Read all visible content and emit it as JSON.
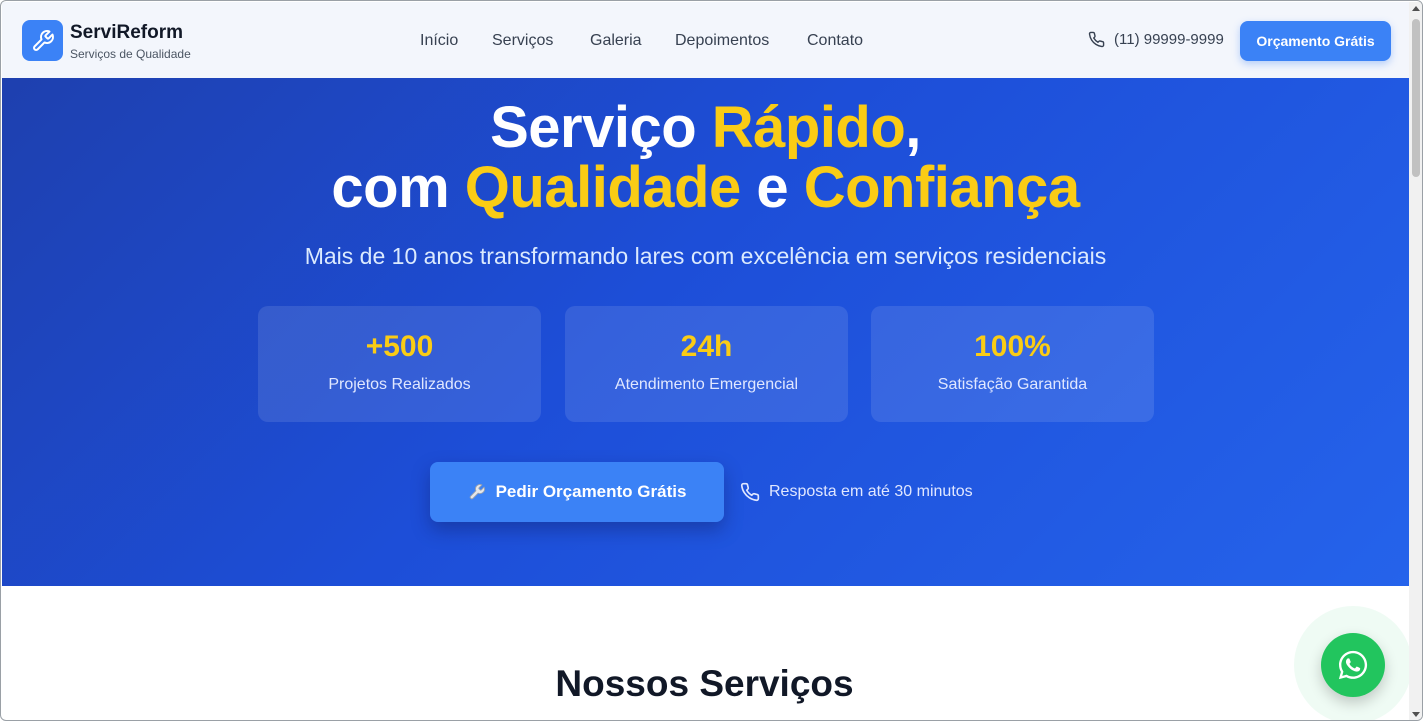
{
  "brand": {
    "name": "ServiReform",
    "tagline": "Serviços de Qualidade",
    "logo_icon": "wrench-icon",
    "accent": "#3b82f6"
  },
  "nav": {
    "items": [
      "Início",
      "Serviços",
      "Galeria",
      "Depoimentos",
      "Contato"
    ]
  },
  "header": {
    "phone": "(11) 99999-9999",
    "phone_icon": "phone-icon",
    "cta_label": "Orçamento Grátis"
  },
  "hero": {
    "title_line1_a": "Serviço ",
    "title_line1_hl": "Rápido",
    "title_line1_b": ",",
    "title_line2_a": "com ",
    "title_line2_hl1": "Qualidade",
    "title_line2_mid": " e ",
    "title_line2_hl2": "Confiança",
    "subtitle": "Mais de 10 anos transformando lares com excelência em serviços residenciais",
    "highlight_color": "#facc15",
    "stats": [
      {
        "value": "+500",
        "label": "Projetos Realizados"
      },
      {
        "value": "24h",
        "label": "Atendimento Emergencial"
      },
      {
        "value": "100%",
        "label": "Satisfação Garantida"
      }
    ],
    "cta_label": "Pedir Orçamento Grátis",
    "cta_icon": "wrench-icon",
    "note": "Resposta em até 30 minutos",
    "note_icon": "phone-icon"
  },
  "services": {
    "title": "Nossos Serviços"
  },
  "whatsapp": {
    "icon": "whatsapp-icon",
    "color": "#22c55e"
  }
}
